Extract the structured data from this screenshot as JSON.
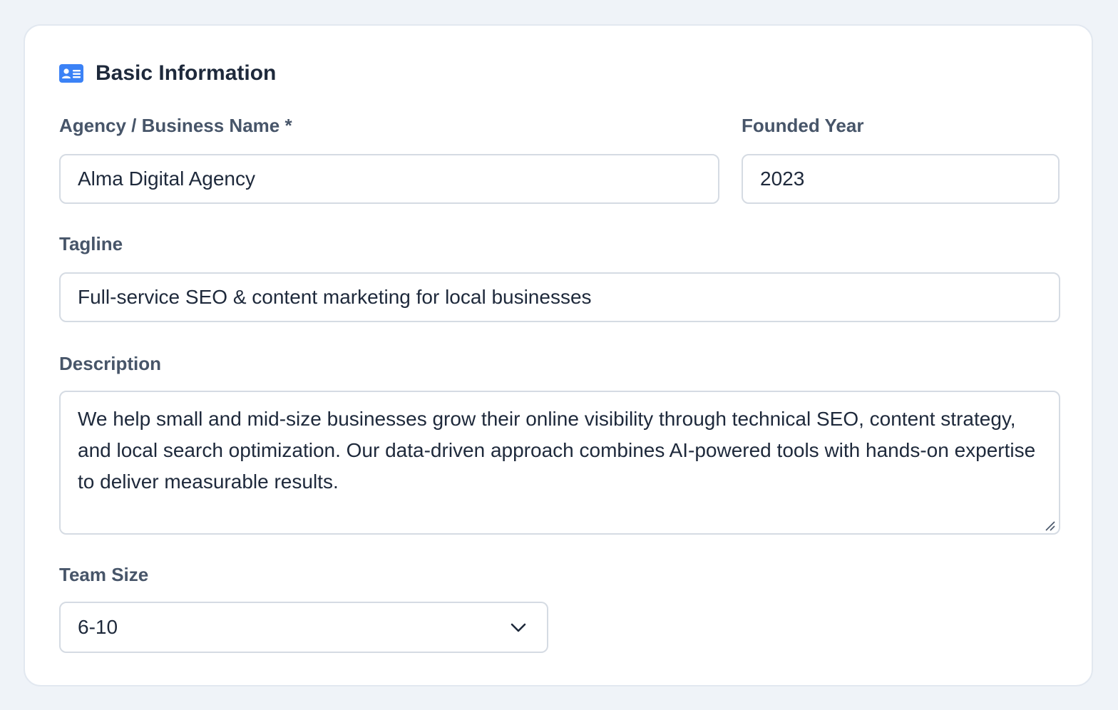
{
  "section": {
    "title": "Basic Information",
    "icon": "id-card-icon",
    "accent_color": "#3b82f6"
  },
  "fields": {
    "business_name": {
      "label": "Agency / Business Name *",
      "value": "Alma Digital Agency"
    },
    "founded_year": {
      "label": "Founded Year",
      "value": "2023"
    },
    "tagline": {
      "label": "Tagline",
      "value": "Full-service SEO & content marketing for local businesses"
    },
    "description": {
      "label": "Description",
      "value": "We help small and mid-size businesses grow their online visibility through technical SEO, content strategy, and local search optimization. Our data-driven approach combines AI-powered tools with hands-on expertise to deliver measurable results."
    },
    "team_size": {
      "label": "Team Size",
      "selected": "6-10",
      "icon": "chevron-down-icon"
    }
  }
}
